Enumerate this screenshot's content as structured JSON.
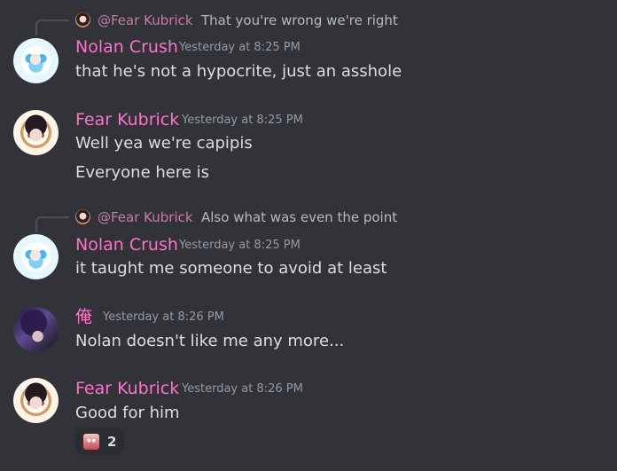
{
  "messages": [
    {
      "reply_to": {
        "mention": "@Fear Kubrick",
        "text": "That you're wrong we're right"
      },
      "author": "Nolan Crush",
      "author_color": "#ff73c6",
      "timestamp": "Yesterday at 8:25 PM",
      "lines": [
        "that he's not a hypocrite, just an asshole"
      ],
      "avatar": "nolan-avatar"
    },
    {
      "author": "Fear Kubrick",
      "author_color": "#ff73c6",
      "timestamp": "Yesterday at 8:25 PM",
      "lines": [
        "Well yea we're capipis",
        "Everyone here is"
      ],
      "avatar": "fear-avatar"
    },
    {
      "reply_to": {
        "mention": "@Fear Kubrick",
        "text": "Also what was even the point"
      },
      "author": "Nolan Crush",
      "author_color": "#ff73c6",
      "timestamp": "Yesterday at 8:25 PM",
      "lines": [
        "it taught me someone to avoid at least"
      ],
      "avatar": "nolan-avatar"
    },
    {
      "author": "俺",
      "author_color": "#ff73c6",
      "timestamp": "Yesterday at 8:26 PM",
      "lines": [
        "Nolan doesn't like me any more..."
      ],
      "avatar": "ore-avatar"
    },
    {
      "author": "Fear Kubrick",
      "author_color": "#ff73c6",
      "timestamp": "Yesterday at 8:26 PM",
      "lines": [
        "Good for him"
      ],
      "avatar": "fear-avatar",
      "reaction": {
        "emoji": "pink-face-emoji",
        "count": "2"
      }
    }
  ],
  "colors": {
    "background": "#313338",
    "text": "#dbdee1",
    "muted": "#949ba4",
    "mention": "#c77ba8",
    "reply_spine": "#4e5058"
  }
}
